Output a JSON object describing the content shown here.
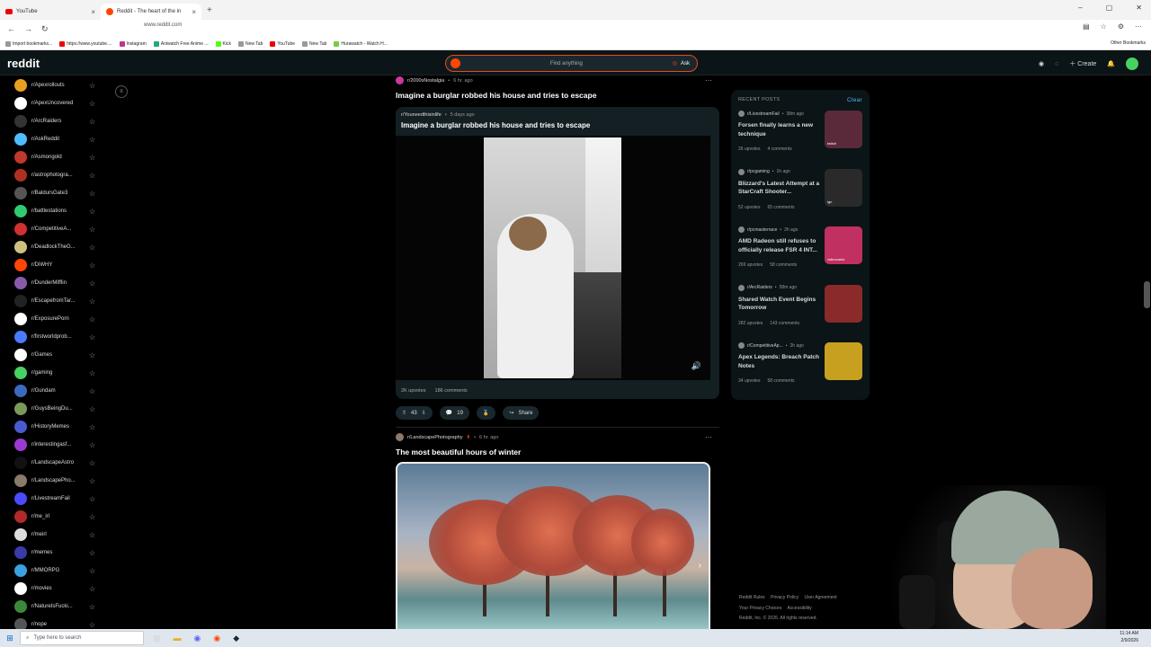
{
  "browser": {
    "tabs": [
      {
        "label": "YouTube"
      },
      {
        "label": "Reddit - The heart of the in"
      }
    ],
    "url": "www.reddit.com",
    "bookmarks": [
      "Import bookmarks...",
      "https://www.youtube....",
      "Instagram",
      "Aniwatch Free Anime ...",
      "Kick",
      "New Tab",
      "YouTube",
      "New Tab",
      "Hurawatch - Watch H..."
    ],
    "other_bookmarks": "Other Bookmarks"
  },
  "reddit_header": {
    "logo": "reddit",
    "search_placeholder": "Find anything",
    "ask_label": "Ask",
    "create_label": "Create"
  },
  "sidebar": {
    "items": [
      {
        "label": "r/Apexrollouts",
        "color": "#e8a020"
      },
      {
        "label": "r/ApexUncovered",
        "color": "#ffffff"
      },
      {
        "label": "r/ArcRaiders",
        "color": "#333333"
      },
      {
        "label": "r/AskReddit",
        "color": "#4fbcff"
      },
      {
        "label": "r/Asmongold",
        "color": "#c0392b"
      },
      {
        "label": "r/astrophotogra...",
        "color": "#b03020"
      },
      {
        "label": "r/BaldursGate3",
        "color": "#555555"
      },
      {
        "label": "r/battlestations",
        "color": "#2ecc71"
      },
      {
        "label": "r/CompetitiveA...",
        "color": "#d03030"
      },
      {
        "label": "r/DeadlockTheG...",
        "color": "#d0c080"
      },
      {
        "label": "r/DiWHY",
        "color": "#ff4500"
      },
      {
        "label": "r/DunderMifflin",
        "color": "#8a5aaa"
      },
      {
        "label": "r/EscapefromTar...",
        "color": "#222222"
      },
      {
        "label": "r/ExposurePorn",
        "color": "#ffffff"
      },
      {
        "label": "r/firstworldprob...",
        "color": "#4a7aff"
      },
      {
        "label": "r/Games",
        "color": "#ffffff"
      },
      {
        "label": "r/gaming",
        "color": "#46d160"
      },
      {
        "label": "r/Gundam",
        "color": "#3a6ac0"
      },
      {
        "label": "r/GuysBeingDu...",
        "color": "#7a9a5a"
      },
      {
        "label": "r/HistoryMemes",
        "color": "#4a5ad0"
      },
      {
        "label": "r/interestingasf...",
        "color": "#9a3ad0"
      },
      {
        "label": "r/LandscapeAstro",
        "color": "#111111"
      },
      {
        "label": "r/LandscapePho...",
        "color": "#8a7a6a"
      },
      {
        "label": "r/LivestreamFail",
        "color": "#4a4aff"
      },
      {
        "label": "r/me_irl",
        "color": "#b02a2a"
      },
      {
        "label": "r/meirl",
        "color": "#dddddd"
      },
      {
        "label": "r/memes",
        "color": "#3a3aaa"
      },
      {
        "label": "r/MMORPG",
        "color": "#3aa0e0"
      },
      {
        "label": "r/movies",
        "color": "#ffffff"
      },
      {
        "label": "r/NatureIsFucki...",
        "color": "#3a8a3a"
      },
      {
        "label": "r/nope",
        "color": "#555555"
      }
    ]
  },
  "feed": {
    "post1": {
      "subreddit": "r/2000sNostalgia",
      "time": "6 hr. ago",
      "title": "Imagine a burglar robbed his house and tries to escape",
      "crosspost": {
        "subreddit": "r/Youneedthisinlife",
        "time": "5 days ago",
        "title": "Imagine a burglar robbed his house and tries to escape",
        "upvotes": "2K upvotes",
        "comments": "186 comments"
      },
      "votes": "43",
      "comments": "19",
      "share": "Share"
    },
    "post2": {
      "subreddit": "r/LandscapePhotography",
      "time": "6 hr. ago",
      "title": "The most beautiful hours of winter"
    }
  },
  "recent": {
    "heading": "RECENT POSTS",
    "clear": "Clear",
    "posts": [
      {
        "sub": "r/LivestreamFail",
        "time": "38m ago",
        "title": "Forsen finally learns a new technique",
        "upvotes": "26 upvotes",
        "comments": "4 comments",
        "thumb": "#5a2a3a",
        "thumb_label": "twitch"
      },
      {
        "sub": "r/pcgaming",
        "time": "1h ago",
        "title": "Blizzard's Latest Attempt at a StarCraft Shooter...",
        "upvotes": "52 upvotes",
        "comments": "65 comments",
        "thumb": "#2a2a2a",
        "thumb_label": "ign"
      },
      {
        "sub": "r/pcmasterrace",
        "time": "2h ago",
        "title": "AMD Radeon still refuses to officially release FSR 4 INT...",
        "upvotes": "269 upvotes",
        "comments": "58 comments",
        "thumb": "#c03060",
        "thumb_label": "videocardz"
      },
      {
        "sub": "r/ArcRaiders",
        "time": "58m ago",
        "title": "Shared Watch Event Begins Tomorrow",
        "upvotes": "282 upvotes",
        "comments": "143 comments",
        "thumb": "#8a2a2a",
        "thumb_label": ""
      },
      {
        "sub": "r/CompetitiveAp...",
        "time": "2h ago",
        "title": "Apex Legends: Breach Patch Notes",
        "upvotes": "34 upvotes",
        "comments": "58 comments",
        "thumb": "#c8a020",
        "thumb_label": ""
      }
    ]
  },
  "footer": {
    "links1": [
      "Reddit Rules",
      "Privacy Policy",
      "User Agreement"
    ],
    "links2": [
      "Your Privacy Choices",
      "Accessibility"
    ],
    "copyright": "Reddit, Inc. © 2026. All rights reserved."
  },
  "taskbar": {
    "search_placeholder": "Type here to search",
    "time": "11:14 AM",
    "date": "2/9/2026"
  }
}
